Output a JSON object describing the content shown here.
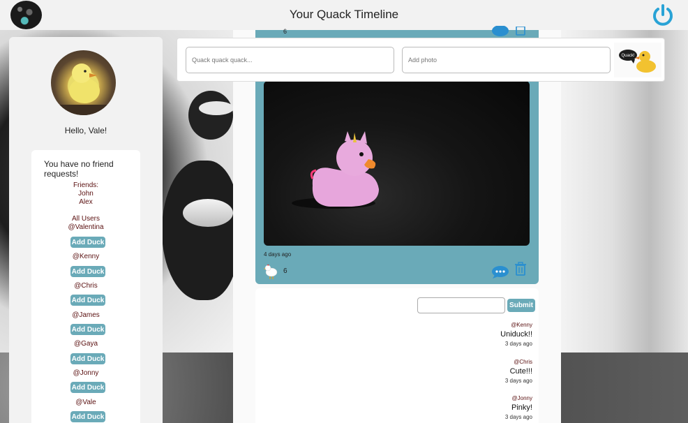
{
  "header": {
    "title": "Your Quack Timeline",
    "logo_icon": "rubber-ducks-logo",
    "power_icon": "power-icon",
    "accent": "#29a3d6"
  },
  "sidebar": {
    "greeting": "Hello, Vale!",
    "friend_requests": "You have no friend requests!",
    "friends_label": "Friends:",
    "friends": [
      "John",
      "Alex"
    ],
    "all_users_label": "All Users",
    "users": [
      {
        "handle": "@Valentina",
        "action": "Add Duck"
      },
      {
        "handle": "@Kenny",
        "action": "Add Duck"
      },
      {
        "handle": "@Chris",
        "action": "Add Duck"
      },
      {
        "handle": "@James",
        "action": "Add Duck"
      },
      {
        "handle": "@Gaya",
        "action": "Add Duck"
      },
      {
        "handle": "@Jonny",
        "action": "Add Duck"
      },
      {
        "handle": "@Vale",
        "action": "Add Duck"
      }
    ]
  },
  "composer": {
    "quack_placeholder": "Quack quack quack...",
    "photo_placeholder": "Add photo",
    "logo_text": "Quack!"
  },
  "posts": [
    {
      "likes": "6"
    },
    {
      "time": "4 days ago",
      "likes": "6",
      "photo_icon": "pink-unicorn-rubber-duck"
    }
  ],
  "comments": {
    "submit_label": "Submit",
    "items": [
      {
        "user": "@Kenny",
        "text": "Uniduck!!",
        "time": "3 days ago"
      },
      {
        "user": "@Chris",
        "text": "Cute!!!",
        "time": "3 days ago"
      },
      {
        "user": "@Jonny",
        "text": "Pinky!",
        "time": "3 days ago"
      }
    ]
  },
  "colors": {
    "post_bg": "#6aaab8",
    "button": "#6aaab8",
    "link_text": "#5a1010"
  }
}
